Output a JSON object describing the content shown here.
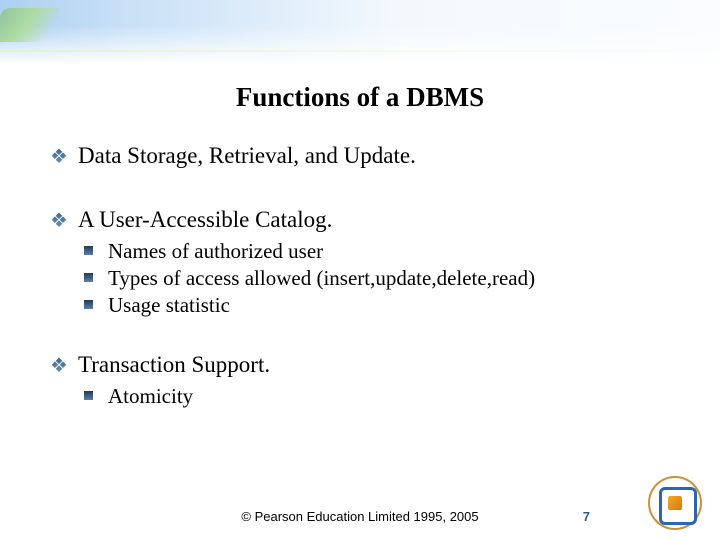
{
  "title": "Functions of a DBMS",
  "items": [
    {
      "text": "Data Storage, Retrieval, and Update.",
      "sub": []
    },
    {
      "text": "A User-Accessible Catalog.",
      "sub": [
        "Names of authorized user",
        "Types of access allowed (insert,update,delete,read)",
        "Usage statistic"
      ]
    },
    {
      "text": "Transaction Support.",
      "sub": [
        "Atomicity"
      ]
    }
  ],
  "footer": "© Pearson Education Limited 1995, 2005",
  "page_number": "7"
}
